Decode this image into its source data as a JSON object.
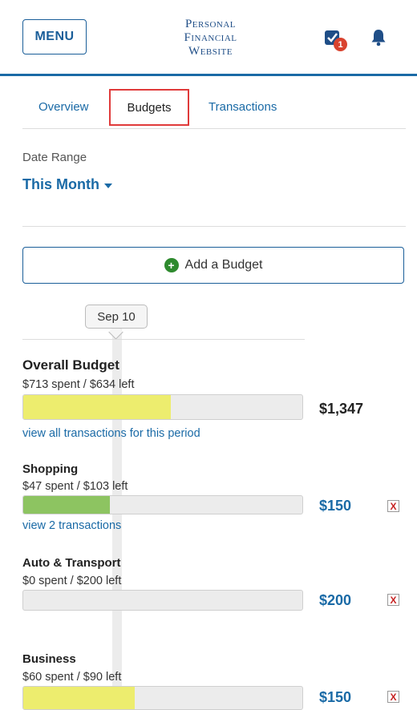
{
  "header": {
    "menu_label": "MENU",
    "title_lines": [
      "Personal",
      "Financial",
      "Website"
    ],
    "notification_count": "1"
  },
  "tabs": [
    {
      "label": "Overview",
      "active": false
    },
    {
      "label": "Budgets",
      "active": true
    },
    {
      "label": "Transactions",
      "active": false
    }
  ],
  "date_range": {
    "label": "Date Range",
    "value": "This Month"
  },
  "add_budget_label": "Add a Budget",
  "timeline_date": "Sep 10",
  "budgets": [
    {
      "name": "Overall Budget",
      "sub": "$713 spent / $634 left",
      "amount": "$1,347",
      "link": "view all transactions for this period",
      "progress": 0.53,
      "color": "#eded6e"
    },
    {
      "name": "Shopping",
      "sub": "$47 spent / $103 left",
      "amount": "$150",
      "link": "view 2 transactions",
      "progress": 0.31,
      "color": "#8dc461"
    },
    {
      "name": "Auto & Transport",
      "sub": "$0 spent / $200 left",
      "amount": "$200",
      "link": "",
      "progress": 0,
      "color": "#8dc461"
    },
    {
      "name": "Business",
      "sub": "$60 spent / $90 left",
      "amount": "$150",
      "link": "",
      "progress": 0.4,
      "color": "#eded6e"
    }
  ],
  "colors": {
    "brand": "#1a6aa6",
    "highlight": "#e03a3a",
    "delete": "#c62222"
  },
  "icons": {
    "check": "checkbox-icon",
    "bell": "bell-icon",
    "add": "plus-circle-icon",
    "delete": "close-x-icon",
    "caret": "caret-down-icon"
  }
}
